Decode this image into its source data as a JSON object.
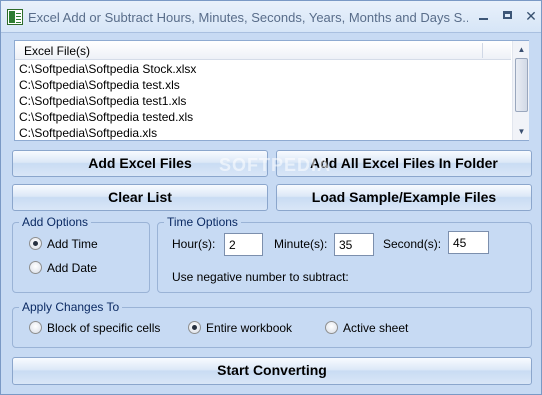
{
  "window": {
    "title": "Excel Add or Subtract Hours, Minutes, Seconds, Years, Months and Days S...",
    "app_icon": "excel-sheet-icon",
    "controls": {
      "minimize": "minimize-icon",
      "maximize": "maximize-icon",
      "close": "✕"
    }
  },
  "file_list": {
    "column_header": "Excel File(s)",
    "items": [
      "C:\\Softpedia\\Softpedia Stock.xlsx",
      "C:\\Softpedia\\Softpedia test.xls",
      "C:\\Softpedia\\Softpedia test1.xls",
      "C:\\Softpedia\\Softpedia tested.xls",
      "C:\\Softpedia\\Softpedia.xls"
    ]
  },
  "buttons": {
    "add_files": "Add Excel Files",
    "add_folder": "Add All Excel Files In Folder",
    "clear_list": "Clear List",
    "load_sample": "Load Sample/Example Files",
    "start": "Start Converting"
  },
  "watermark": "SOFTPEDIA",
  "add_options": {
    "title": "Add Options",
    "options": [
      {
        "label": "Add Time",
        "checked": true
      },
      {
        "label": "Add Date",
        "checked": false
      }
    ]
  },
  "time_options": {
    "title": "Time Options",
    "hours_label": "Hour(s):",
    "hours_value": "2",
    "minutes_label": "Minute(s):",
    "minutes_value": "35",
    "seconds_label": "Second(s):",
    "seconds_value": "45",
    "note": "Use negative number to subtract:"
  },
  "apply_changes": {
    "title": "Apply Changes To",
    "options": [
      {
        "label": "Block of specific cells",
        "checked": false
      },
      {
        "label": "Entire workbook",
        "checked": true
      },
      {
        "label": "Active sheet",
        "checked": false
      }
    ]
  },
  "colors": {
    "background": "#c7daf3",
    "group_title": "#0b2a63",
    "border": "#8ba6cc"
  }
}
